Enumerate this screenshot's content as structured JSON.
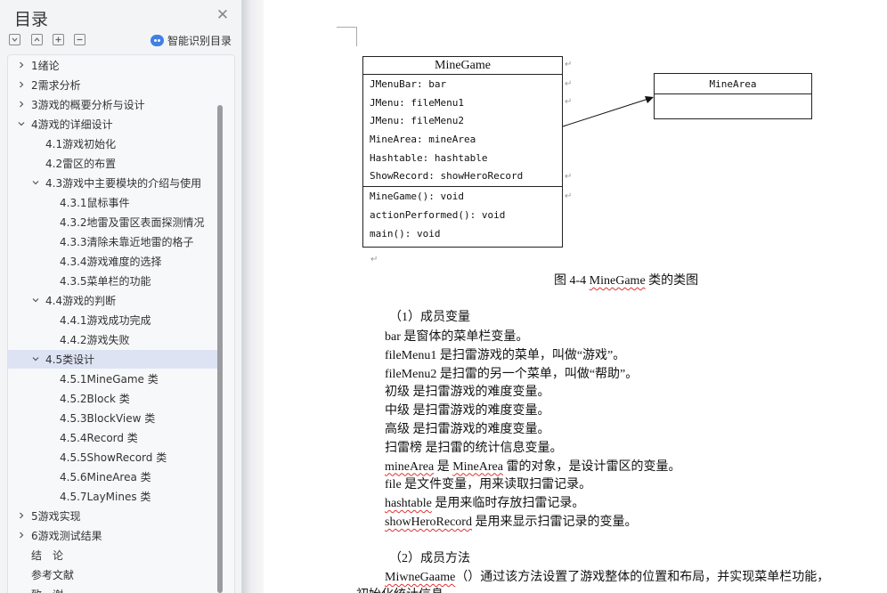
{
  "sidebar": {
    "title": "目录",
    "close_icon": "close-icon",
    "toolbar": [
      "collapse-all-icon",
      "expand-all-icon",
      "add-item-icon",
      "remove-item-icon"
    ],
    "smart_label": "智能识别目录",
    "toc": [
      {
        "label": "1绪论",
        "caret": "right"
      },
      {
        "label": "2需求分析",
        "caret": "right"
      },
      {
        "label": "3游戏的概要分析与设计",
        "caret": "right"
      },
      {
        "label": "4游戏的详细设计",
        "caret": "down"
      },
      {
        "label": "4.1游戏初始化"
      },
      {
        "label": "4.2雷区的布置"
      },
      {
        "label": "4.3游戏中主要模块的介绍与使用",
        "caret": "down"
      },
      {
        "label": "4.3.1鼠标事件"
      },
      {
        "label": "4.3.2地雷及雷区表面探测情况"
      },
      {
        "label": "4.3.3清除未靠近地雷的格子"
      },
      {
        "label": "4.3.4游戏难度的选择"
      },
      {
        "label": "4.3.5菜单栏的功能"
      },
      {
        "label": "4.4游戏的判断",
        "caret": "down"
      },
      {
        "label": "4.4.1游戏成功完成"
      },
      {
        "label": "4.4.2游戏失败"
      },
      {
        "label": "4.5类设计",
        "caret": "down",
        "selected": true
      },
      {
        "label": "4.5.1MineGame 类"
      },
      {
        "label": "4.5.2Block 类"
      },
      {
        "label": "4.5.3BlockView 类"
      },
      {
        "label": "4.5.4Record 类"
      },
      {
        "label": "4.5.5ShowRecord 类"
      },
      {
        "label": "4.5.6MineArea 类"
      },
      {
        "label": "4.5.7LayMines 类"
      },
      {
        "label": "5游戏实现",
        "caret": "right"
      },
      {
        "label": "6游戏测试结果",
        "caret": "right"
      },
      {
        "label": "结　论"
      },
      {
        "label": "参考文献"
      },
      {
        "label": "致　谢"
      }
    ]
  },
  "document": {
    "diagram": {
      "minegame": {
        "title": "MineGame",
        "attributes": [
          "JMenuBar: bar",
          "JMenu: fileMenu1",
          "JMenu: fileMenu2",
          "MineArea: mineArea",
          "Hashtable: hashtable",
          "ShowRecord: showHeroRecord"
        ],
        "methods": [
          "MineGame(): void",
          "actionPerformed(): void",
          "main(): void"
        ]
      },
      "minearea": {
        "title": "MineArea"
      }
    },
    "caption": {
      "prefix": "图 4-4 ",
      "name": "MineGame",
      "suffix": " 类的类图"
    },
    "section1_title": "（1）成员变量",
    "members": [
      {
        "term": "bar",
        "desc": " 是窗体的菜单栏变量。"
      },
      {
        "term": "fileMenu1",
        "desc": " 是扫雷游戏的菜单，叫做“游戏”。"
      },
      {
        "term": "fileMenu2",
        "desc": " 是扫雷的另一个菜单，叫做“帮助”。"
      },
      {
        "term": "初级",
        "desc": " 是扫雷游戏的难度变量。"
      },
      {
        "term": "中级",
        "desc": " 是扫雷游戏的难度变量。"
      },
      {
        "term": "高级",
        "desc": " 是扫雷游戏的难度变量。"
      },
      {
        "term": "扫雷榜",
        "desc": " 是扫雷的统计信息变量。"
      },
      {
        "term": "mineArea",
        "desc": " 是 ",
        "term2": "MineArea",
        "desc2": " 雷的对象，是设计雷区的变量。"
      },
      {
        "term": "file",
        "desc": " 是文件变量，用来读取扫雷记录。"
      },
      {
        "term": "hashtable",
        "desc": " 是用来临时存放扫雷记录。"
      },
      {
        "term": "showHeroRecord",
        "desc": " 是用来显示扫雷记录的变量。"
      }
    ],
    "section2_title": "（2）成员方法",
    "method_term": "MiwneGaame",
    "method_desc": "（）通过该方法设置了游戏整体的位置和布局，并实现菜单栏功能，",
    "method_cont": "初始化统计信息。"
  }
}
